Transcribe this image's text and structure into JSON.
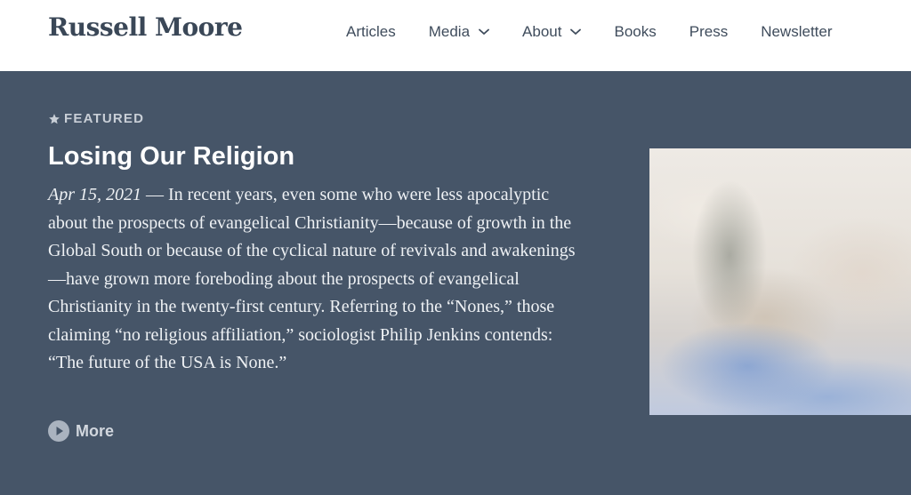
{
  "site": {
    "logo": "Russell Moore"
  },
  "nav": {
    "items": [
      {
        "label": "Articles",
        "has_dropdown": false
      },
      {
        "label": "Media",
        "has_dropdown": true
      },
      {
        "label": "About",
        "has_dropdown": true
      },
      {
        "label": "Books",
        "has_dropdown": false
      },
      {
        "label": "Press",
        "has_dropdown": false
      },
      {
        "label": "Newsletter",
        "has_dropdown": false
      }
    ]
  },
  "featured": {
    "tag": "FEATURED",
    "icon": "star-icon",
    "title": "Losing Our Religion",
    "date": "Apr 15, 2021",
    "separator": " — ",
    "excerpt": "In recent years, even some who were less apocalyptic about the prospects of evangelical Christianity—because of growth in the Global South or because of the cyclical nature of revivals and awakenings—have grown more foreboding about the prospects of evangelical Christianity in the twenty-first century. Referring to the “Nones,” those claiming “no religious affiliation,” sociologist Philip Jenkins contends: “The future of the USA is None.”",
    "more_label": "More",
    "more_icon": "play-circle-icon"
  },
  "colors": {
    "header_bg": "#ffffff",
    "hero_bg": "#465568",
    "logo_text": "#3a4757",
    "nav_text": "#3f4c5c"
  }
}
